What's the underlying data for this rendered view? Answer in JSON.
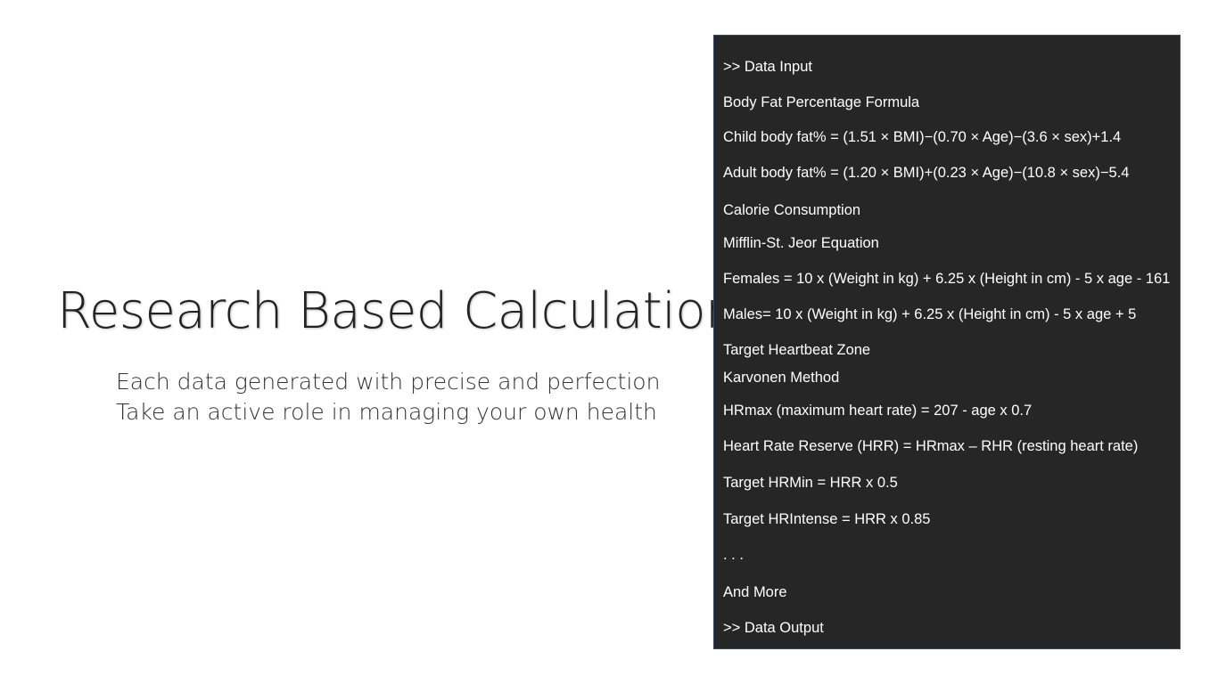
{
  "hero": {
    "title": "Research Based Calculation",
    "tagline_lines": [
      "Each data generated with precise and perfection",
      "Take an active role in managing your own health"
    ]
  },
  "panel": {
    "lines": [
      ">> Data Input",
      "Body Fat Percentage Formula",
      "Child body fat% = (1.51 × BMI)−(0.70 × Age)−(3.6 × sex)+1.4",
      "Adult body fat% = (1.20 × BMI)+(0.23 × Age)−(10.8 × sex)−5.4",
      "Calorie Consumption",
      "Mifflin-St. Jeor Equation",
      "Females = 10 x (Weight in kg) + 6.25 x (Height in cm) - 5 x age - 161",
      "Males= 10 x (Weight in kg) + 6.25 x (Height in cm) - 5 x age + 5",
      "Target Heartbeat Zone",
      "Karvonen Method",
      "HRmax (maximum heart rate)  = 207 - age x 0.7",
      "Heart Rate Reserve (HRR) = HRmax – RHR (resting heart rate)",
      "Target HRMin = HRR x 0.5",
      "Target HRIntense = HRR x 0.85",
      ". . .",
      "And More",
      ">> Data Output"
    ]
  }
}
